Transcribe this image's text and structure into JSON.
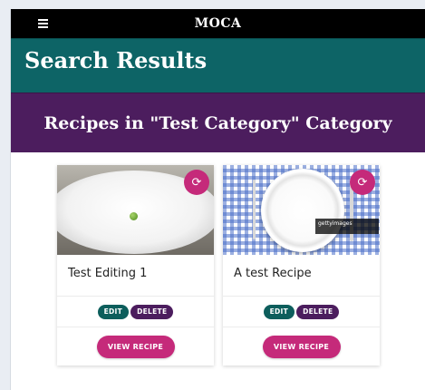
{
  "navbar": {
    "brand": "MOCA",
    "menu_icon": "hamburger-icon"
  },
  "page": {
    "title": "Search Results",
    "category_heading": "Recipes in \"Test Category\" Category"
  },
  "colors": {
    "navbar": "#000000",
    "teal": "#0d6466",
    "purple": "#4c1d5e",
    "pink": "#c52a7a"
  },
  "recipes": [
    {
      "title": "Test Editing 1",
      "image": "plate-with-pea",
      "sync_icon": "sync-icon",
      "edit_label": "EDIT",
      "delete_label": "DELETE",
      "view_label": "VIEW RECIPE"
    },
    {
      "title": "A test Recipe",
      "image": "plate-on-checkered-cloth",
      "image_watermark": "gettyimages",
      "sync_icon": "sync-icon",
      "edit_label": "EDIT",
      "delete_label": "DELETE",
      "view_label": "VIEW RECIPE"
    }
  ]
}
